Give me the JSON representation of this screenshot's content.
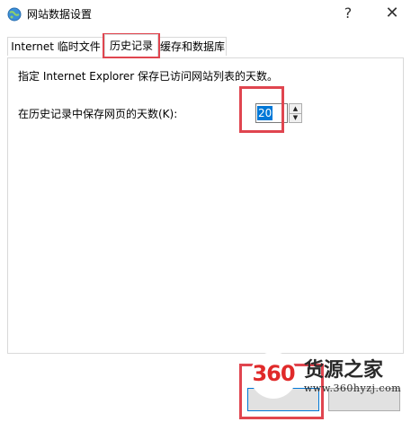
{
  "window": {
    "title": "网站数据设置",
    "help_glyph": "?",
    "close_glyph": "✕"
  },
  "tabs": [
    {
      "label": "Internet 临时文件"
    },
    {
      "label": "历史记录",
      "selected": true
    },
    {
      "label": "缓存和数据库"
    }
  ],
  "history": {
    "description": "指定 Internet Explorer 保存已访问网站列表的天数。",
    "days_label": "在历史记录中保存网页的天数(K):",
    "days_value": "20",
    "spin_up": "▲",
    "spin_down": "▼"
  },
  "watermark": {
    "logo_number": "360",
    "brand": "货源之家",
    "url": "www.360hyzj.com"
  },
  "colors": {
    "highlight": "#e0454f",
    "selection": "#0078d7",
    "logo_red": "#e02a2a"
  }
}
